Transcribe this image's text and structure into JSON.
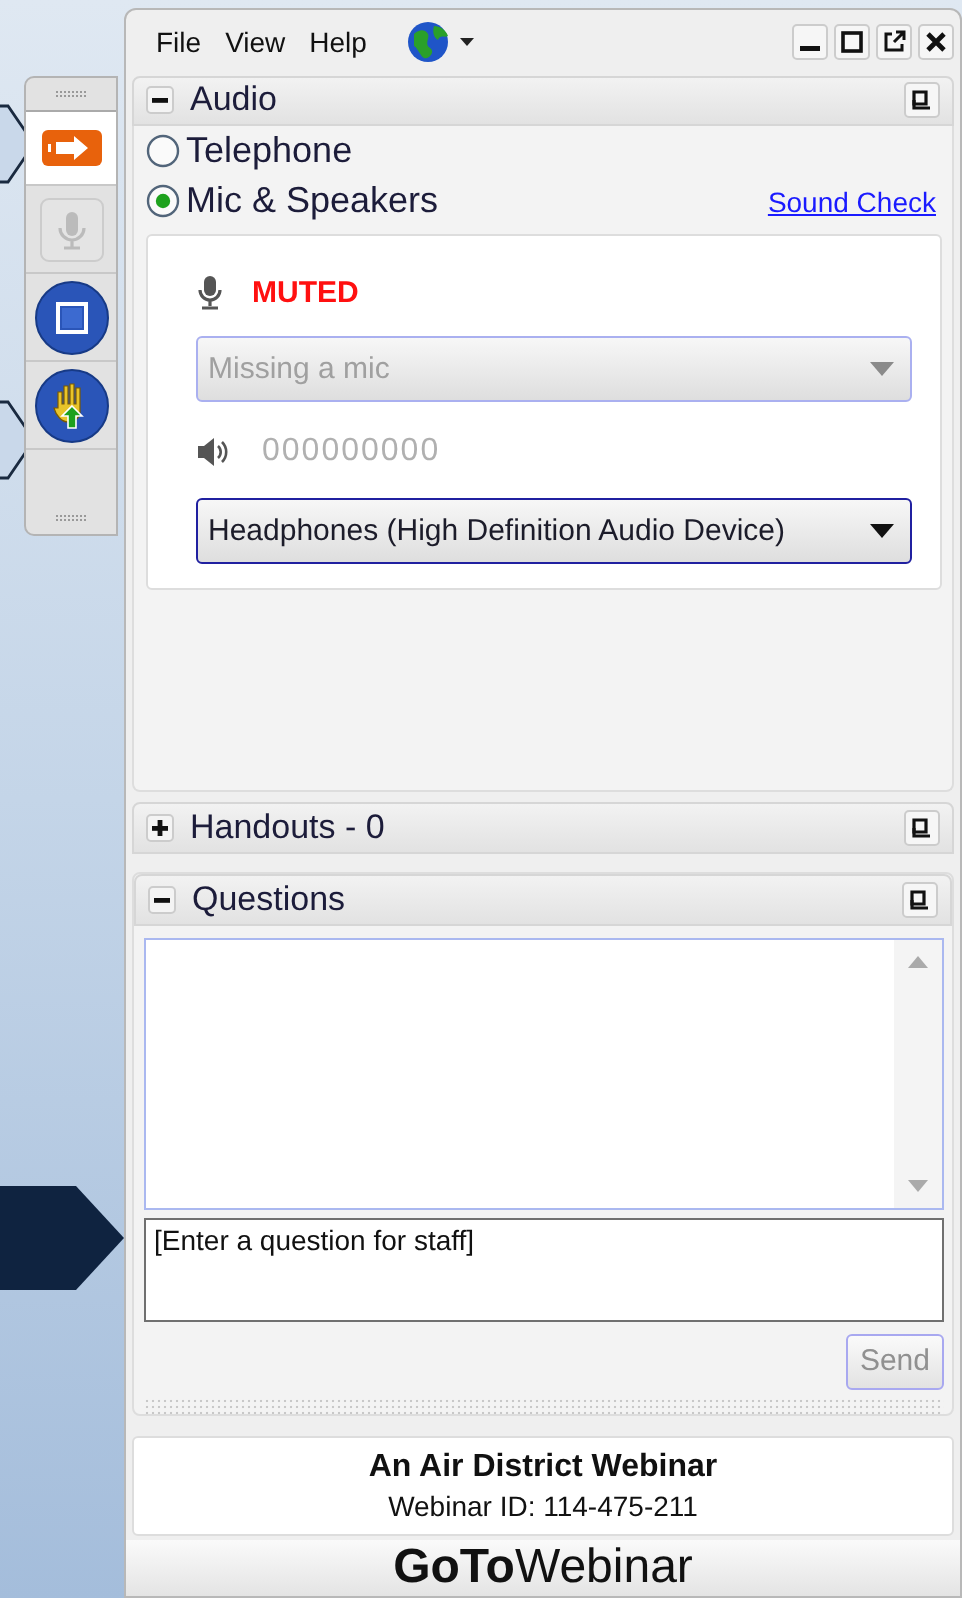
{
  "menu": [
    {
      "label": "File"
    },
    {
      "label": "View"
    },
    {
      "label": "Help"
    }
  ],
  "toolbar": [
    {
      "kind": "arrow",
      "selected": true
    },
    {
      "kind": "mic",
      "selected": false
    },
    {
      "kind": "screen",
      "selected": false
    },
    {
      "kind": "hand",
      "selected": false
    }
  ],
  "audio": {
    "title": "Audio",
    "expanded": true,
    "options": [
      {
        "label": "Telephone",
        "selected": false
      },
      {
        "label": "Mic & Speakers",
        "selected": true
      }
    ],
    "sound_check": "Sound Check",
    "mic_status": "MUTED",
    "mic_select": {
      "value": "Missing a mic",
      "disabled": true
    },
    "speaker_meter": "000000000",
    "speaker_select": {
      "value": "Headphones (High Definition Audio Device)",
      "disabled": false
    }
  },
  "handouts": {
    "title": "Handouts - 0",
    "expanded": false
  },
  "questions": {
    "title": "Questions",
    "expanded": true,
    "placeholder": "[Enter a question for staff]",
    "send": "Send"
  },
  "webinar": {
    "title": "An Air District Webinar",
    "id": "Webinar ID: 114-475-211"
  },
  "brand": "**GoTo**Webinar"
}
